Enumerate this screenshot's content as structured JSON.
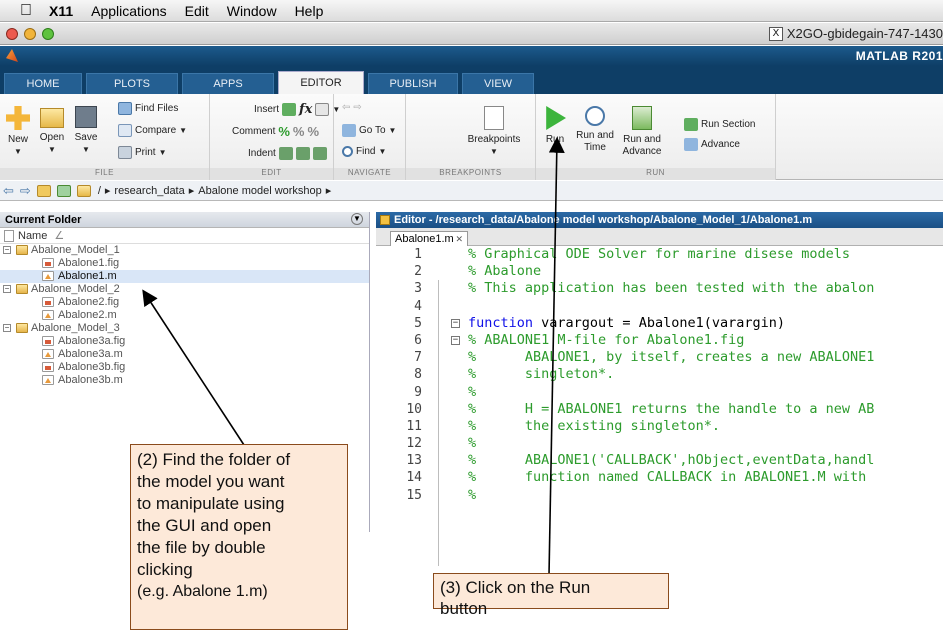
{
  "menubar": {
    "app": "X11",
    "items": [
      "Applications",
      "Edit",
      "Window",
      "Help"
    ]
  },
  "window": {
    "title": "X2GO-gbidegain-747-1430"
  },
  "matlab_bar": {
    "title": "MATLAB R201"
  },
  "tabs": [
    "HOME",
    "PLOTS",
    "APPS",
    "EDITOR",
    "PUBLISH",
    "VIEW"
  ],
  "active_tab": "EDITOR",
  "ribbon": {
    "file": {
      "label": "FILE",
      "new": "New",
      "open": "Open",
      "save": "Save",
      "find_files": "Find Files",
      "compare": "Compare",
      "print": "Print"
    },
    "edit": {
      "label": "EDIT",
      "insert": "Insert",
      "comment": "Comment",
      "indent": "Indent",
      "fx": "fx"
    },
    "navigate": {
      "label": "NAVIGATE",
      "goto": "Go To",
      "find": "Find"
    },
    "breakpoints": {
      "label": "BREAKPOINTS",
      "breakpoints": "Breakpoints"
    },
    "run": {
      "label": "RUN",
      "run": "Run",
      "run_and_time_1": "Run and",
      "run_and_time_2": "Time",
      "run_and_advance_1": "Run and",
      "run_and_advance_2": "Advance",
      "run_section": "Run Section",
      "advance": "Advance"
    }
  },
  "address": {
    "root": "/",
    "crumbs": [
      "research_data",
      "Abalone model workshop"
    ]
  },
  "current_folder": {
    "title": "Current Folder",
    "column": "Name",
    "sort_indicator": "∠",
    "items": [
      {
        "name": "Abalone_Model_1",
        "type": "folder",
        "level": 0
      },
      {
        "name": "Abalone1.fig",
        "type": "fig",
        "level": 1
      },
      {
        "name": "Abalone1.m",
        "type": "m",
        "level": 1,
        "selected": true
      },
      {
        "name": "Abalone_Model_2",
        "type": "folder",
        "level": 0
      },
      {
        "name": "Abalone2.fig",
        "type": "fig",
        "level": 1
      },
      {
        "name": "Abalone2.m",
        "type": "m",
        "level": 1
      },
      {
        "name": "Abalone_Model_3",
        "type": "folder",
        "level": 0
      },
      {
        "name": "Abalone3a.fig",
        "type": "fig",
        "level": 1
      },
      {
        "name": "Abalone3a.m",
        "type": "m",
        "level": 1
      },
      {
        "name": "Abalone3b.fig",
        "type": "fig",
        "level": 1
      },
      {
        "name": "Abalone3b.m",
        "type": "m",
        "level": 1
      }
    ]
  },
  "editor": {
    "title": "Editor - /research_data/Abalone model workshop/Abalone_Model_1/Abalone1.m",
    "file_tab": "Abalone1.m",
    "lines": [
      {
        "n": "1",
        "text": "% Graphical ODE Solver for marine disese models"
      },
      {
        "n": "2",
        "text": "% Abalone"
      },
      {
        "n": "3",
        "text": "% This application has been tested with the abalon"
      },
      {
        "n": "4",
        "text": ""
      },
      {
        "n": "5",
        "kw": "function",
        "text": " varargout = Abalone1(varargin)"
      },
      {
        "n": "6",
        "text": "% ABALONE1 M-file for Abalone1.fig"
      },
      {
        "n": "7",
        "text": "%      ABALONE1, by itself, creates a new ABALONE1"
      },
      {
        "n": "8",
        "text": "%      singleton*."
      },
      {
        "n": "9",
        "text": "%"
      },
      {
        "n": "10",
        "text": "%      H = ABALONE1 returns the handle to a new AB"
      },
      {
        "n": "11",
        "text": "%      the existing singleton*."
      },
      {
        "n": "12",
        "text": "%"
      },
      {
        "n": "13",
        "text": "%      ABALONE1('CALLBACK',hObject,eventData,handl"
      },
      {
        "n": "14",
        "text": "%      function named CALLBACK in ABALONE1.M with"
      },
      {
        "n": "15",
        "text": "%"
      }
    ]
  },
  "annotations": {
    "step2": [
      "(2) Find the folder of",
      "the model you want",
      "to manipulate using",
      "the GUI and open",
      "the file by double",
      "clicking",
      "(e.g. Abalone 1.m)"
    ],
    "step3": [
      "(3) Click on the Run",
      "button"
    ]
  },
  "colors": {
    "matlab_blue": "#0e3e66",
    "comment_green": "#2c9b2c",
    "keyword_blue": "#1010e8",
    "callout_fill": "#fde9d9",
    "run_green": "#3cb43c"
  }
}
